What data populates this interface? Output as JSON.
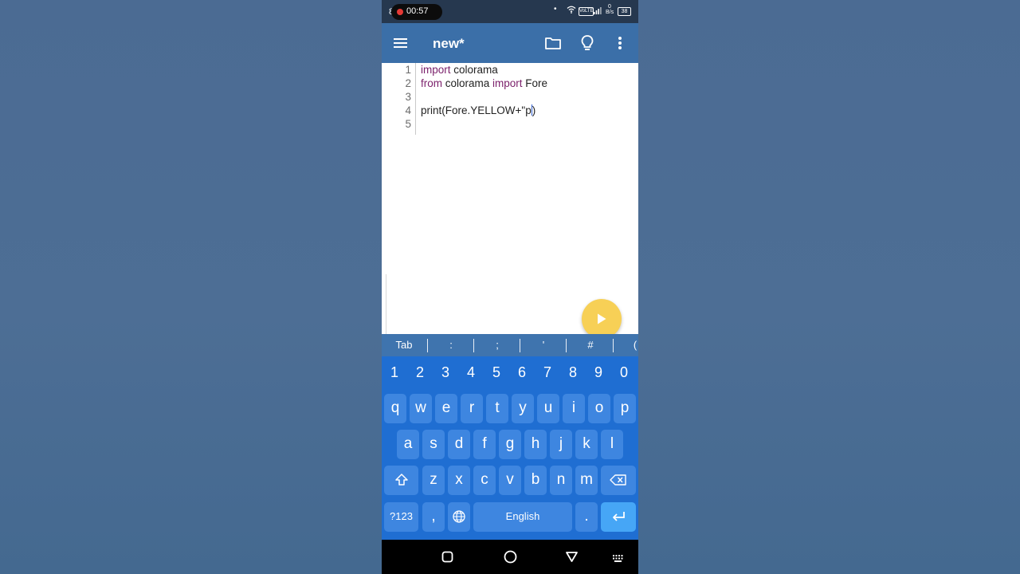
{
  "status_bar": {
    "clock_fragment": "8",
    "recording_time": "00:57",
    "network_speed_top": "0",
    "network_speed_unit": "B/s",
    "volte": "VoLTE",
    "battery": "38"
  },
  "toolbar": {
    "title": "new*",
    "menu_icon": "hamburger-menu-icon",
    "folder_icon": "folder-icon",
    "bulb_icon": "lightbulb-icon",
    "more_icon": "more-vert-icon"
  },
  "editor": {
    "line_numbers": [
      "1",
      "2",
      "3",
      "4",
      "5"
    ],
    "line1": {
      "kw": "import",
      "rest": " colorama"
    },
    "line2": {
      "kw1": "from",
      "mid": " colorama ",
      "kw2": "import",
      "rest": " Fore"
    },
    "line4": {
      "before_cursor": "print(Fore.YELLOW+\"p",
      "after_cursor": ")"
    },
    "run_icon": "play-icon"
  },
  "symbol_bar": {
    "keys": [
      "Tab",
      ":",
      ";",
      "'",
      "#",
      "("
    ]
  },
  "keyboard": {
    "numbers": [
      "1",
      "2",
      "3",
      "4",
      "5",
      "6",
      "7",
      "8",
      "9",
      "0"
    ],
    "row1": [
      "q",
      "w",
      "e",
      "r",
      "t",
      "y",
      "u",
      "i",
      "o",
      "p"
    ],
    "row2": [
      "a",
      "s",
      "d",
      "f",
      "g",
      "h",
      "j",
      "k",
      "l"
    ],
    "row3": [
      "z",
      "x",
      "c",
      "v",
      "b",
      "n",
      "m"
    ],
    "symbols_key": "?123",
    "comma_key": ",",
    "space_label": "English",
    "period_key": ".",
    "shift_icon": "shift-icon",
    "backspace_icon": "backspace-icon",
    "globe_icon": "globe-icon",
    "enter_icon": "enter-icon"
  },
  "colors": {
    "toolbar": "#3b6fa8",
    "keyboard": "#1f6ed2",
    "key": "#3e86e0",
    "keyword": "#7a1f6a",
    "run_button": "#f7d056"
  }
}
